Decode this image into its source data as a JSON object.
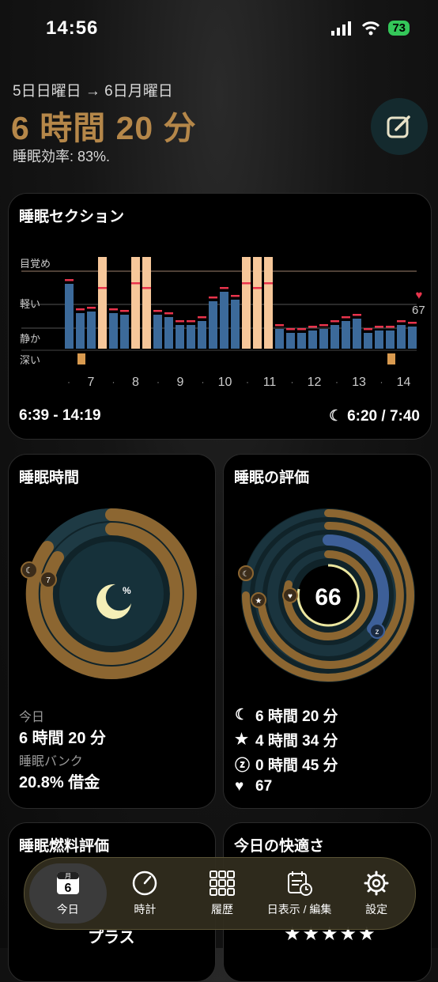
{
  "status": {
    "time": "14:56",
    "battery": "73"
  },
  "header": {
    "date_range": "5日日曜日 → 6日月曜日",
    "duration": "6 時間 20 分",
    "efficiency": "睡眠効率: 83%."
  },
  "sessions": {
    "title": "睡眠セクション",
    "y_labels": [
      "目覚め",
      "軽い",
      "静か",
      "深い"
    ],
    "x_labels": [
      "7",
      "8",
      "9",
      "10",
      "11",
      "12",
      "13",
      "14"
    ],
    "heart_value": "67",
    "time_range": "6:39 - 14:19",
    "in_bed": "6:20 / 7:40"
  },
  "sleep_time": {
    "title": "睡眠時間",
    "center_icon": "%",
    "label_today": "今日",
    "value_today": "6 時間 20 分",
    "label_bank": "睡眠バンク",
    "value_bank": "20.8% 借金",
    "ring_badge": "7"
  },
  "score": {
    "title": "睡眠の評価",
    "value": "66",
    "rows": [
      {
        "icon": "moon-icon",
        "text": "6 時間 20 分"
      },
      {
        "icon": "star-icon",
        "text": "4 時間 34 分"
      },
      {
        "icon": "z-icon",
        "text": "0 時間 45 分"
      },
      {
        "icon": "heart-icon",
        "text": "67"
      }
    ]
  },
  "fuel": {
    "title": "睡眠燃料評価",
    "label": "プラス"
  },
  "comfort": {
    "title": "今日の快適さ",
    "stars": "★★★★★"
  },
  "tabs": [
    {
      "label": "今日",
      "icon": "calendar-icon",
      "month": "月",
      "day": "6"
    },
    {
      "label": "時計",
      "icon": "clock-icon"
    },
    {
      "label": "履歴",
      "icon": "grid-icon"
    },
    {
      "label": "日表示 / 編集",
      "icon": "calendar-clock-icon"
    },
    {
      "label": "設定",
      "icon": "gear-icon"
    }
  ],
  "colors": {
    "accent": "#b58749",
    "ring_gold": "#8c6631",
    "ring_dark": "#163039",
    "blue_bar": "#3c6a9a",
    "peach_bar": "#f6c79a",
    "red_mark": "#e8344c"
  }
}
